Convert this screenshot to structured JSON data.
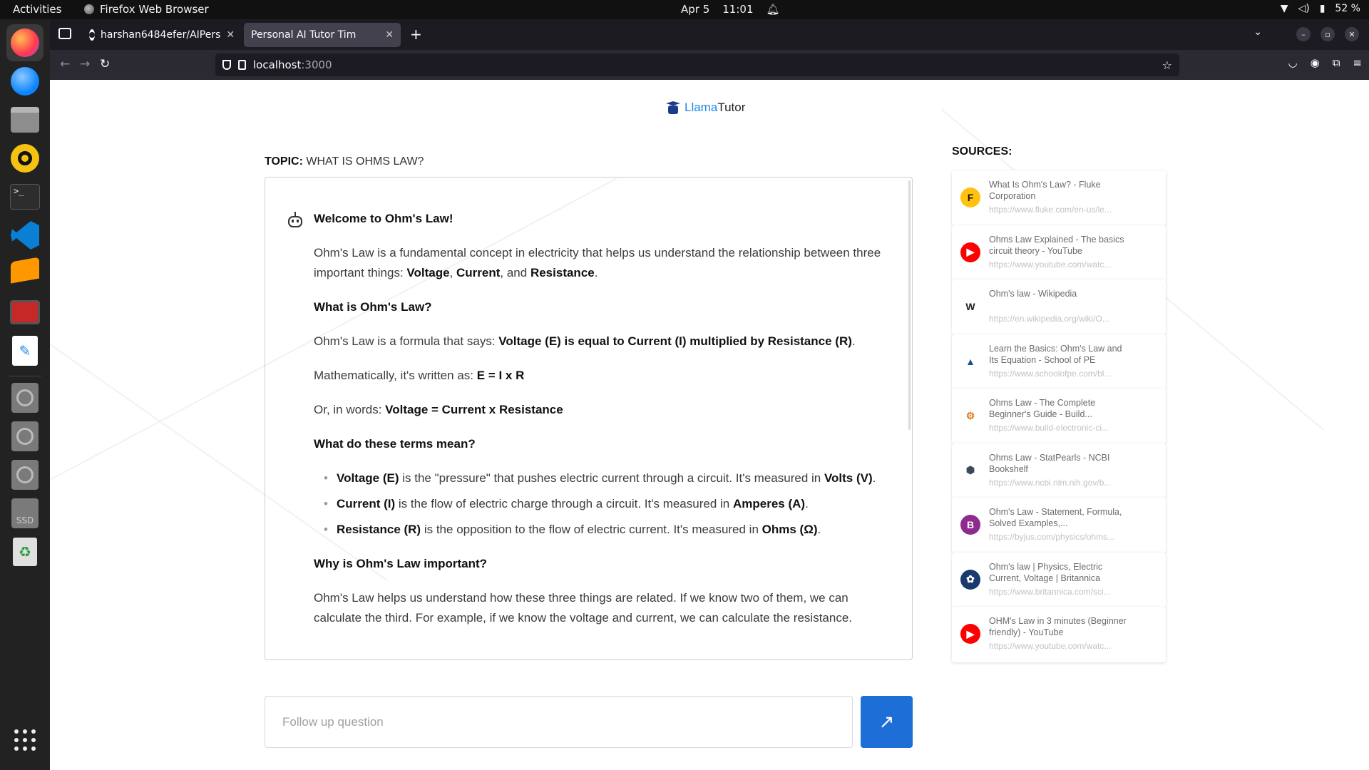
{
  "topbar": {
    "activities": "Activities",
    "app": "Firefox Web Browser",
    "date": "Apr 5",
    "time": "11:01",
    "battery": "52 %"
  },
  "browser": {
    "tabs": [
      {
        "label": "harshan6484efer/AIPers"
      },
      {
        "label": "Personal AI Tutor Tim"
      }
    ],
    "url_host": "localhost",
    "url_port": ":3000"
  },
  "app": {
    "logo_llama": "Llama",
    "logo_tutor": "Tutor",
    "topic_label": "TOPIC:",
    "topic_value": "WHAT IS OHMS LAW?",
    "followup_placeholder": "Follow up question",
    "send_icon": "↗"
  },
  "message": {
    "welcome": "Welcome to Ohm's Law!",
    "p1_a": "Ohm's Law is a fundamental concept in electricity that helps us understand the relationship between three important things: ",
    "p1_voltage": "Voltage",
    "p1_comma": ", ",
    "p1_current": "Current",
    "p1_and": ", and ",
    "p1_resistance": "Resistance",
    "p1_end": ".",
    "h_what": "What is Ohm's Law?",
    "p2_a": "Ohm's Law is a formula that says: ",
    "p2_b": "Voltage (E) is equal to Current (I) multiplied by Resistance (R)",
    "p2_end": ".",
    "p3_a": "Mathematically, it's written as: ",
    "p3_b": "E = I x R",
    "p4_a": "Or, in words: ",
    "p4_b": "Voltage = Current x Resistance",
    "h_terms": "What do these terms mean?",
    "li1_a": "Voltage (E)",
    "li1_b": " is the \"pressure\" that pushes electric current through a circuit. It's measured in ",
    "li1_c": "Volts (V)",
    "li1_end": ".",
    "li2_a": "Current (I)",
    "li2_b": " is the flow of electric charge through a circuit. It's measured in ",
    "li2_c": "Amperes (A)",
    "li2_end": ".",
    "li3_a": "Resistance (R)",
    "li3_b": " is the opposition to the flow of electric current. It's measured in ",
    "li3_c": "Ohms (Ω)",
    "li3_end": ".",
    "h_why": "Why is Ohm's Law important?",
    "p5": "Ohm's Law helps us understand how these three things are related. If we know two of them, we can calculate the third. For example, if we know the voltage and current, we can calculate the resistance."
  },
  "sources": {
    "title": "SOURCES:",
    "items": [
      {
        "title": "What Is Ohm's Law? - Fluke Corporation",
        "url": "https://www.fluke.com/en-us/le...",
        "icon": "F",
        "icon_bg": "#ffc20e",
        "icon_fg": "#111"
      },
      {
        "title": "Ohms Law Explained - The basics circuit theory - YouTube",
        "url": "https://www.youtube.com/watc...",
        "icon": "▶",
        "icon_bg": "#ff0000",
        "icon_fg": "#fff"
      },
      {
        "title": "Ohm's law - Wikipedia",
        "url": "https://en.wikipedia.org/wiki/O...",
        "icon": "W",
        "icon_bg": "#ffffff",
        "icon_fg": "#222"
      },
      {
        "title": "Learn the Basics: Ohm's Law and Its Equation - School of PE",
        "url": "https://www.schoolofpe.com/bl...",
        "icon": "▲",
        "icon_bg": "#ffffff",
        "icon_fg": "#1f4e8c"
      },
      {
        "title": "Ohms Law - The Complete Beginner's Guide - Build...",
        "url": "https://www.build-electronic-ci...",
        "icon": "⚙",
        "icon_bg": "#ffffff",
        "icon_fg": "#e07b1a"
      },
      {
        "title": "Ohms Law - StatPearls - NCBI Bookshelf",
        "url": "https://www.ncbi.nlm.nih.gov/b...",
        "icon": "⬢",
        "icon_bg": "#ffffff",
        "icon_fg": "#3b4a5a"
      },
      {
        "title": "Ohm's Law - Statement, Formula, Solved Examples,...",
        "url": "https://byjus.com/physics/ohms...",
        "icon": "B",
        "icon_bg": "#8e2b8c",
        "icon_fg": "#fff"
      },
      {
        "title": "Ohm's law | Physics, Electric Current, Voltage | Britannica",
        "url": "https://www.britannica.com/sci...",
        "icon": "✿",
        "icon_bg": "#1a3a6b",
        "icon_fg": "#fff"
      },
      {
        "title": "OHM's Law in 3 minutes (Beginner friendly) - YouTube",
        "url": "https://www.youtube.com/watc...",
        "icon": "▶",
        "icon_bg": "#ff0000",
        "icon_fg": "#fff"
      }
    ]
  }
}
